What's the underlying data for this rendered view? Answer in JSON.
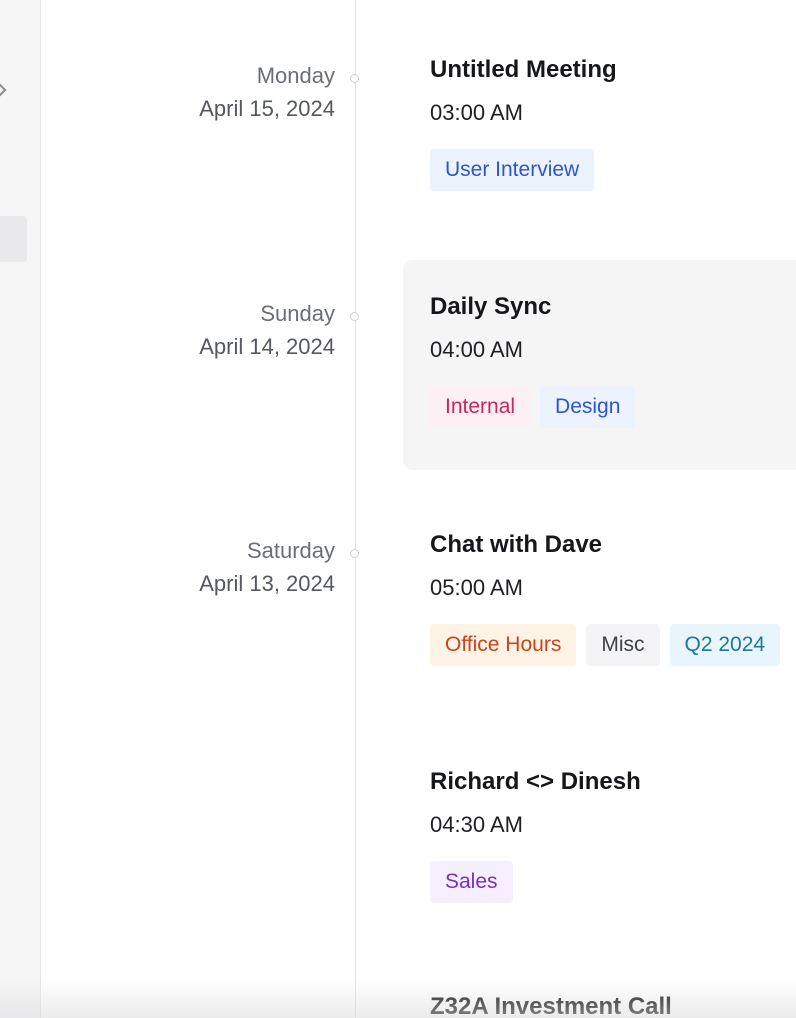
{
  "timeline": {
    "dates": [
      {
        "day": "Monday",
        "date": "April 15, 2024"
      },
      {
        "day": "Sunday",
        "date": "April 14, 2024"
      },
      {
        "day": "Saturday",
        "date": "April 13, 2024"
      }
    ],
    "events": [
      {
        "title": "Untitled Meeting",
        "time": "03:00 AM",
        "tags": [
          {
            "label": "User Interview",
            "color": "#2c56c9"
          }
        ]
      },
      {
        "title": "Daily Sync",
        "time": "04:00 AM",
        "tags": [
          {
            "label": "Internal",
            "color": "#c8275a"
          },
          {
            "label": "Design",
            "color": "#2c56c9"
          }
        ]
      },
      {
        "title": "Chat with Dave",
        "time": "05:00 AM",
        "tags": [
          {
            "label": "Office Hours",
            "color": "#c8461c"
          },
          {
            "label": "Misc",
            "color": "#3f4249"
          },
          {
            "label": "Q2 2024",
            "color": "#1c7897"
          }
        ]
      },
      {
        "title": "Richard <> Dinesh",
        "time": "04:30 AM",
        "tags": [
          {
            "label": "Sales",
            "color": "#7a2cc8"
          }
        ]
      },
      {
        "title": "Z32A Investment Call",
        "time": "",
        "tags": []
      }
    ]
  }
}
